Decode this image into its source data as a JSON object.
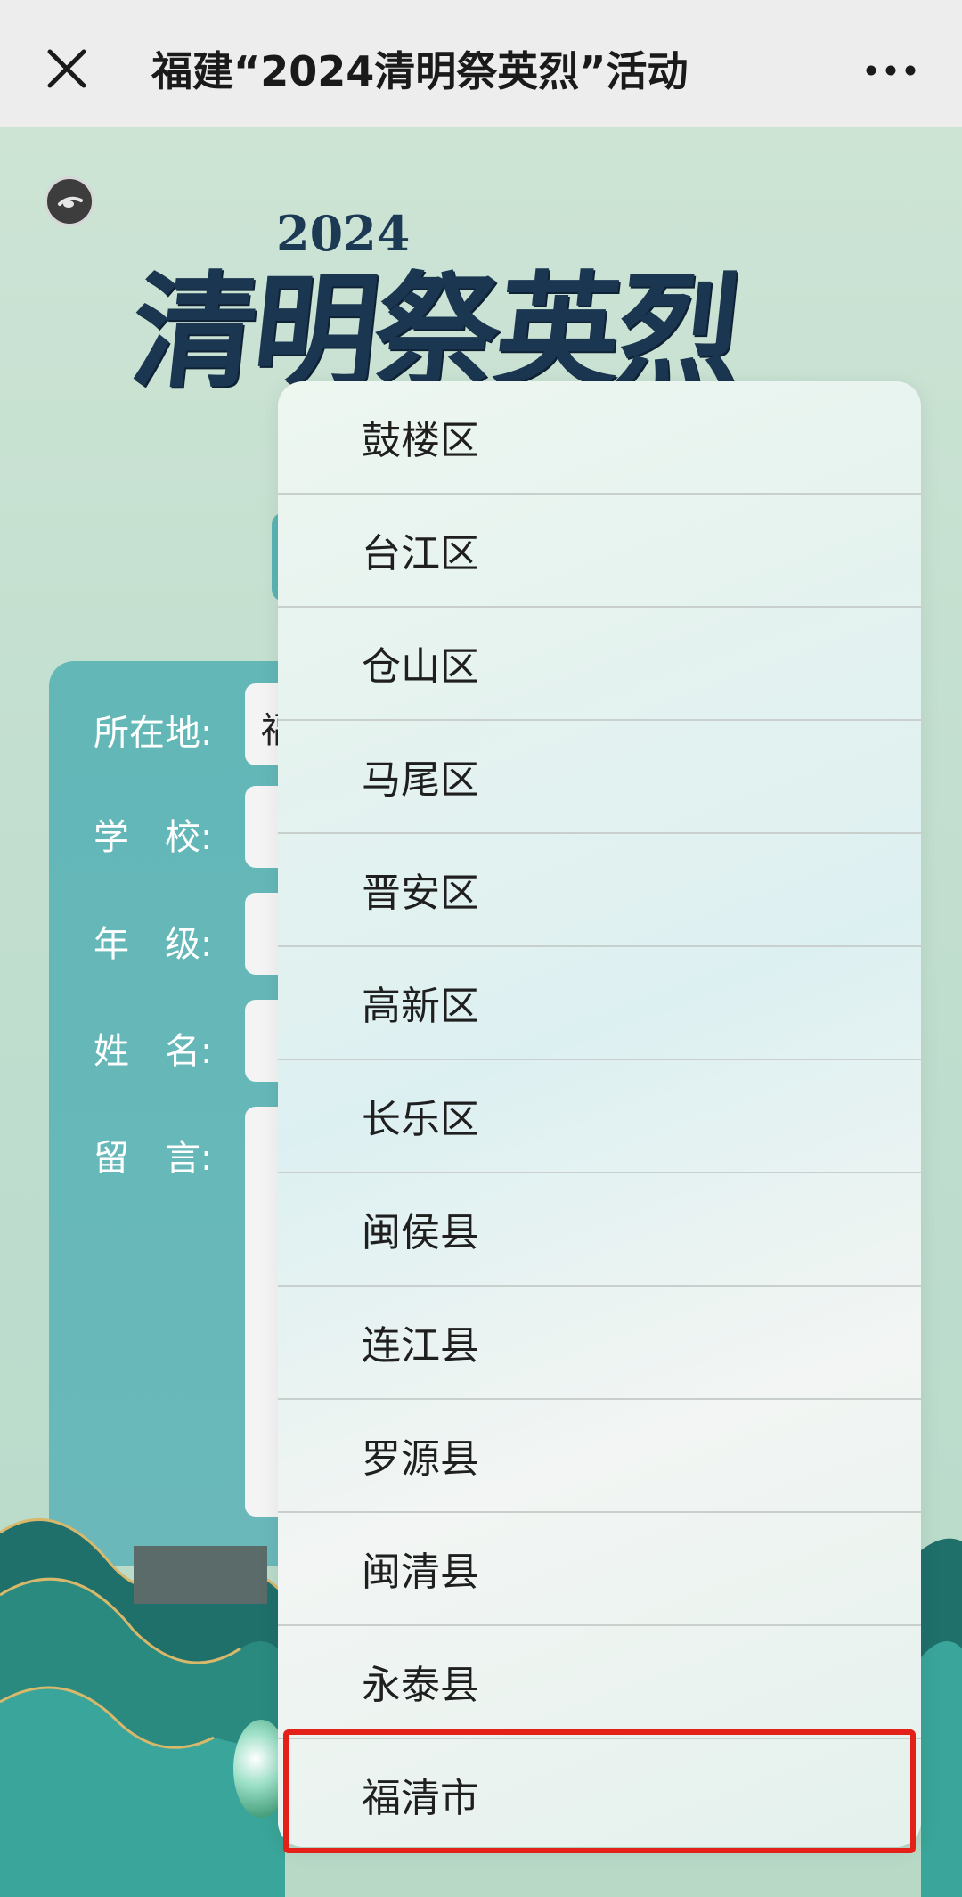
{
  "nav": {
    "title": "福建“2024清明祭英烈”活动",
    "close_icon": "close-icon",
    "more_icon": "more-icon"
  },
  "hero": {
    "year": "2024",
    "text": "清明祭英烈"
  },
  "form": {
    "labels": [
      "所在地:",
      "学　校:",
      "年　级:",
      "姓　名:",
      "留　言:"
    ],
    "location_prefix": "福"
  },
  "dropdown": {
    "options": [
      "鼓楼区",
      "台江区",
      "仓山区",
      "马尾区",
      "晋安区",
      "高新区",
      "长乐区",
      "闽侯县",
      "连江县",
      "罗源县",
      "闽清县",
      "永泰县",
      "福清市"
    ],
    "highlighted": "福清市"
  },
  "colors": {
    "accent": "#e32119",
    "card": "#63b7b7",
    "hero": "#1b3651"
  }
}
